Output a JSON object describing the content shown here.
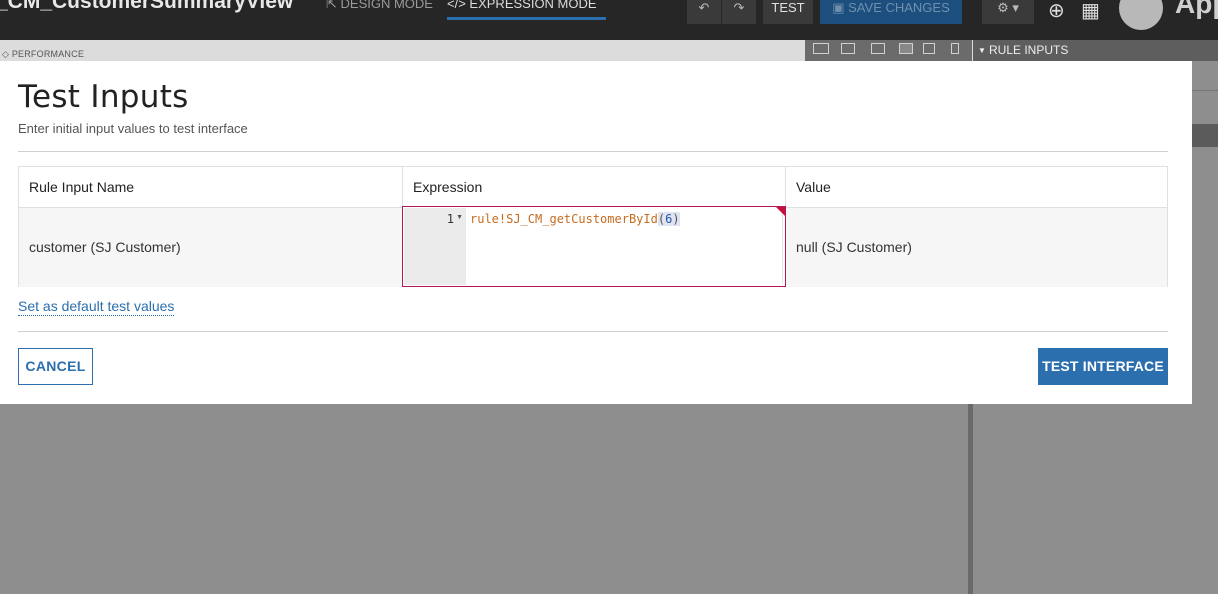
{
  "app": {
    "title": "_CM_CustomerSummaryView",
    "design_mode_label": "DESIGN MODE",
    "expression_mode_label": "EXPRESSION MODE",
    "test_label": "TEST",
    "save_changes_label": "SAVE CHANGES",
    "brand": "App"
  },
  "subbar": {
    "performance_label": "PERFORMANCE",
    "rule_inputs_label": "RULE INPUTS"
  },
  "icons": {
    "undo": "undo-icon",
    "redo": "redo-icon",
    "gear": "gear-icon",
    "globe_search": "globe-search-icon",
    "apps_grid": "apps-grid-icon",
    "avatar": "user-avatar"
  },
  "modal": {
    "title": "Test Inputs",
    "subtitle": "Enter initial input values to test interface",
    "columns": [
      "Rule Input Name",
      "Expression",
      "Value"
    ],
    "rows": [
      {
        "name": "customer (SJ Customer)",
        "expression_line_number": "1",
        "expression_func": "rule!SJ_CM_getCustomerById",
        "expression_open": "(",
        "expression_arg": "6",
        "expression_close": ")",
        "value": "null (SJ Customer)"
      }
    ],
    "default_link": "Set as default test values",
    "cancel_label": "CANCEL",
    "test_interface_label": "TEST INTERFACE"
  },
  "colors": {
    "primary": "#2c6fae",
    "editor_error_border": "#b5175b",
    "code_function": "#c76b1f",
    "topbar": "#262626"
  }
}
